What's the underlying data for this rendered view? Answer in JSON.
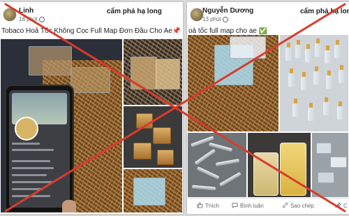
{
  "left_post": {
    "author": "Linh",
    "time": "18 phút",
    "group": "cẩm phả hạ long",
    "caption": "Tobaco Hoả Tốc Không Cọc Full Map Đơn Đầu Cho Ae📌"
  },
  "right_post": {
    "author": "Nguyễn Dương",
    "time": "13 phút",
    "group": "cẩm phả hạ long",
    "caption": "oả tốc full map cho ae ✅",
    "actions": {
      "like": "Thích",
      "comment": "Bình luận",
      "copy": "Sao chép",
      "share": "C"
    }
  },
  "overlay": {
    "cross_color": "#d93b2b"
  }
}
